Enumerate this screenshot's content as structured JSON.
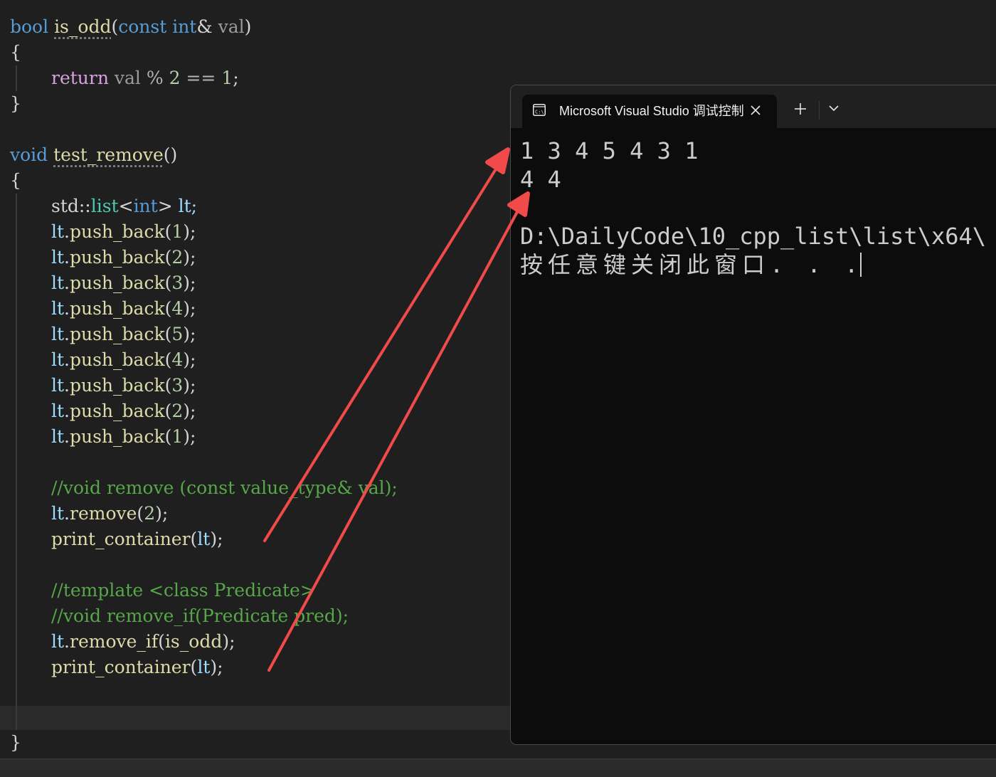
{
  "code": {
    "func1_kw": "bool",
    "func1_name": "is_odd",
    "func1_params": "(const int& val)",
    "func1_p_const": "const",
    "func1_p_int": "int",
    "func1_p_amp": "&",
    "func1_p_val": "val",
    "open_brace": "{",
    "close_brace": "}",
    "return_kw": "return",
    "return_expr_val": "val",
    "return_expr_mod": "%",
    "return_expr_2": "2",
    "return_expr_eq": "==",
    "return_expr_1": "1",
    "func2_kw": "void",
    "func2_name": "test_remove",
    "func2_parens": "()",
    "decl_ns": "std::",
    "decl_list": "list",
    "decl_lt": "<",
    "decl_int": "int",
    "decl_gt": ">",
    "decl_var": " lt;",
    "push_obj": "lt",
    "push_method": "push_back",
    "push_args": [
      "1",
      "2",
      "3",
      "4",
      "5",
      "4",
      "3",
      "2",
      "1"
    ],
    "comment_remove": "//void remove (const value_type& val);",
    "remove_method": "remove",
    "remove_arg": "2",
    "print_fn": "print_container",
    "print_arg": "lt",
    "comment_template": "//template <class Predicate>",
    "comment_remove_if": "//void remove_if(Predicate pred);",
    "remove_if_method": "remove_if",
    "remove_if_arg": "is_odd"
  },
  "console": {
    "tab_title": "Microsoft Visual Studio 调试控制台",
    "tab_icon": "console-app-icon",
    "close_icon": "close-icon",
    "new_tab_icon": "plus-icon",
    "dropdown_icon": "chevron-down-icon",
    "output_lines": [
      "1 3 4 5 4 3 1",
      "4 4",
      "",
      "D:\\DailyCode\\10_cpp_list\\list\\x64\\",
      "按任意键关闭此窗口. . ."
    ]
  },
  "colors": {
    "editor_bg": "#1f1f1f",
    "console_bg": "#0c0c0c",
    "arrow": "#f04a4a",
    "keyword": "#569cd6",
    "function": "#dcdcaa",
    "comment": "#57a64a",
    "type": "#4ec9b0"
  }
}
